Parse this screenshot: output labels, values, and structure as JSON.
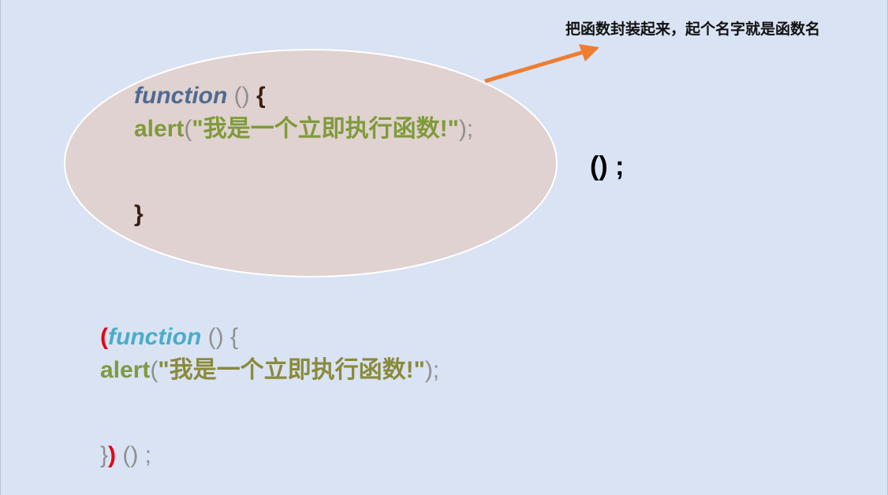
{
  "annotation": {
    "text": "把函数封装起来，起个名字就是函数名"
  },
  "colors": {
    "background": "#d9e3f4",
    "ellipse_fill": "#e0d2d0",
    "ellipse_stroke": "#ffffff",
    "arrow": "#ee7d31",
    "keyword_top": "#4f6a8f",
    "keyword_bottom": "#4bacc6",
    "alert": "#7f9a3a",
    "string": "#8a8a3a",
    "punct_top": "#3a1e12",
    "punct_grey": "#8f8f8f",
    "paren_red": "#e30613"
  },
  "top_code": {
    "keyword": "function",
    "params": " ()",
    "open_brace": " {",
    "alert_fn": "alert",
    "alert_open": "(",
    "alert_string": "\"我是一个立即执行函数!\"",
    "alert_close": ");",
    "close_brace": "}"
  },
  "standalone_call": {
    "text": "() ;"
  },
  "bottom_code": {
    "wrap_open": "(",
    "keyword": "function",
    "params": " () {",
    "alert_fn": "alert",
    "alert_open": "(",
    "alert_string": "\"我是一个立即执行函数!\"",
    "alert_close": ");",
    "close_brace": "}",
    "wrap_close": ")",
    "call": " () ;"
  }
}
